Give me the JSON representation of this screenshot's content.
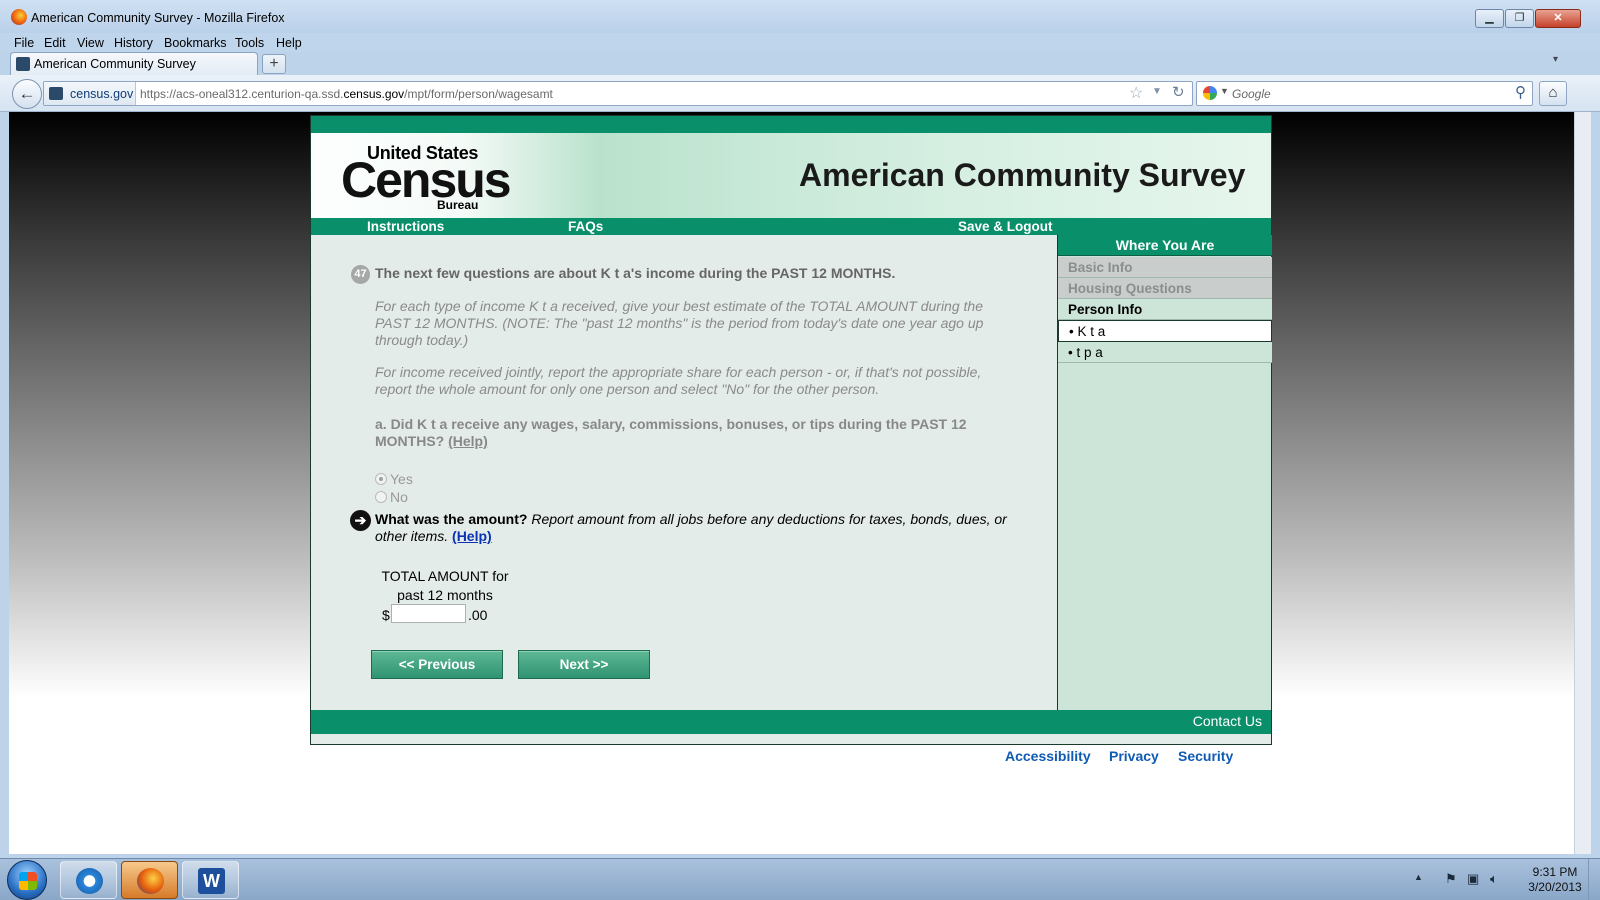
{
  "window": {
    "title": "American Community Survey - Mozilla Firefox"
  },
  "menu": [
    "File",
    "Edit",
    "View",
    "History",
    "Bookmarks",
    "Tools",
    "Help"
  ],
  "tab": {
    "label": "American Community Survey"
  },
  "nav": {
    "site_identity": "census.gov",
    "url_prefix": "https://acs-oneal312.centurion-qa.ssd.",
    "url_domain": "census.gov",
    "url_suffix": "/mpt/form/person/wagesamt",
    "search_placeholder": "Google"
  },
  "page": {
    "logo": {
      "line1": "United States",
      "line2": "Census",
      "line3": "Bureau"
    },
    "survey_title": "American Community Survey",
    "nav_links": [
      "Instructions",
      "FAQs",
      "Save & Logout"
    ],
    "sidebar": {
      "header": "Where You Are",
      "items": [
        "Basic Info",
        "Housing Questions",
        "Person Info",
        "• K t a",
        "• t p a"
      ]
    },
    "question": {
      "number": "47",
      "intro": "The next few questions are about K t a's income during the PAST 12 MONTHS.",
      "para1": "For each type of income K t a received, give your best estimate of the TOTAL AMOUNT during the PAST 12 MONTHS. (NOTE: The \"past 12 months\" is the period from today's date one year ago up through today.)",
      "para2": "For income received jointly, report the appropriate share for each person - or, if that's not possible, report the whole amount for only one person and select \"No\" for the other person.",
      "part_a": "a. Did K t a receive any wages, salary, commissions, bonuses, or tips during the PAST 12 MONTHS?",
      "help": "(Help)",
      "options": [
        "Yes",
        "No"
      ],
      "selected": "Yes",
      "amount_q_bold": "What was the amount?",
      "amount_q_italic": "Report amount from all jobs before any deductions for taxes, bonds, dues, or other items.",
      "amount_label_1": "TOTAL AMOUNT for",
      "amount_label_2": "past 12 months",
      "currency": "$",
      "amount_value": "",
      "cents": ".00"
    },
    "buttons": {
      "previous": "<<   Previous",
      "next": "Next   >>"
    },
    "footer": {
      "contact": "Contact Us",
      "links": [
        "Accessibility",
        "Privacy",
        "Security"
      ]
    }
  },
  "taskbar": {
    "time": "9:31 PM",
    "date": "3/20/2013"
  },
  "colors": {
    "census_green": "#0a8f6b",
    "sidebar_bg": "#cde4d8",
    "link_blue": "#0f5bb4"
  }
}
